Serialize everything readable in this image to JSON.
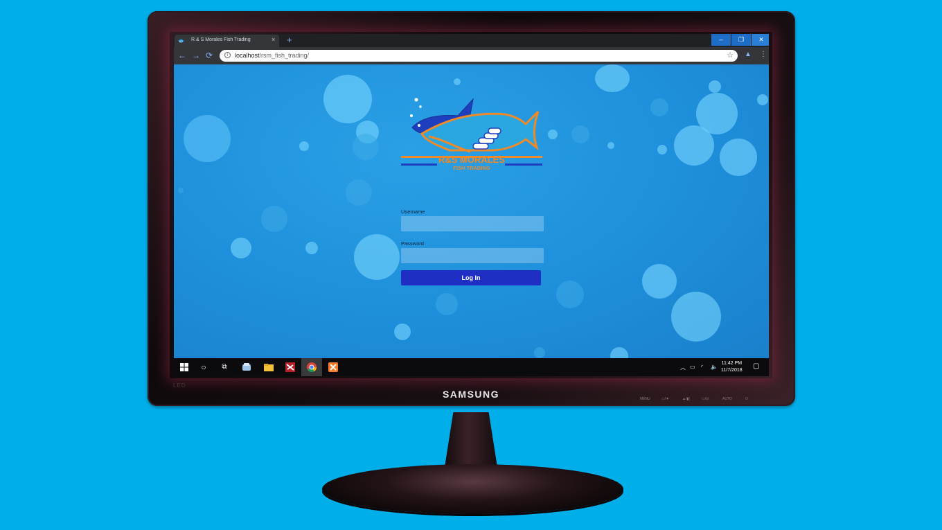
{
  "browser": {
    "tab_title": "R & S Morales Fish Trading",
    "tab_close": "×",
    "new_tab": "+",
    "window_controls": {
      "minimize": "–",
      "restore": "❐",
      "close": "✕"
    },
    "nav": {
      "back": "←",
      "forward": "→",
      "reload": "⟳"
    },
    "url_host": "localhost",
    "url_path": "/rsm_fish_trading/"
  },
  "logo": {
    "line1": "R&S MORALES",
    "line2": "FISH TRADING",
    "colors": {
      "orange": "#f08a28",
      "navy": "#1d3fbf",
      "fish_blue": "#2aa7e0"
    }
  },
  "login": {
    "username_label": "Username",
    "password_label": "Password",
    "button_label": "Log In",
    "button_color": "#1f2fc4"
  },
  "taskbar": {
    "time": "11:42 PM",
    "date": "11/7/2018",
    "icons": [
      "windows-start-icon",
      "search-circle-icon",
      "task-view-icon",
      "app-icon",
      "file-explorer-icon",
      "app-red-icon",
      "chrome-icon",
      "xampp-icon"
    ]
  },
  "monitor": {
    "brand": "SAMSUNG",
    "badge": "LED",
    "buttons": [
      "MENU",
      "▭/▼",
      "▲/◧",
      "▭/⊡",
      "AUTO",
      "⏻"
    ]
  }
}
